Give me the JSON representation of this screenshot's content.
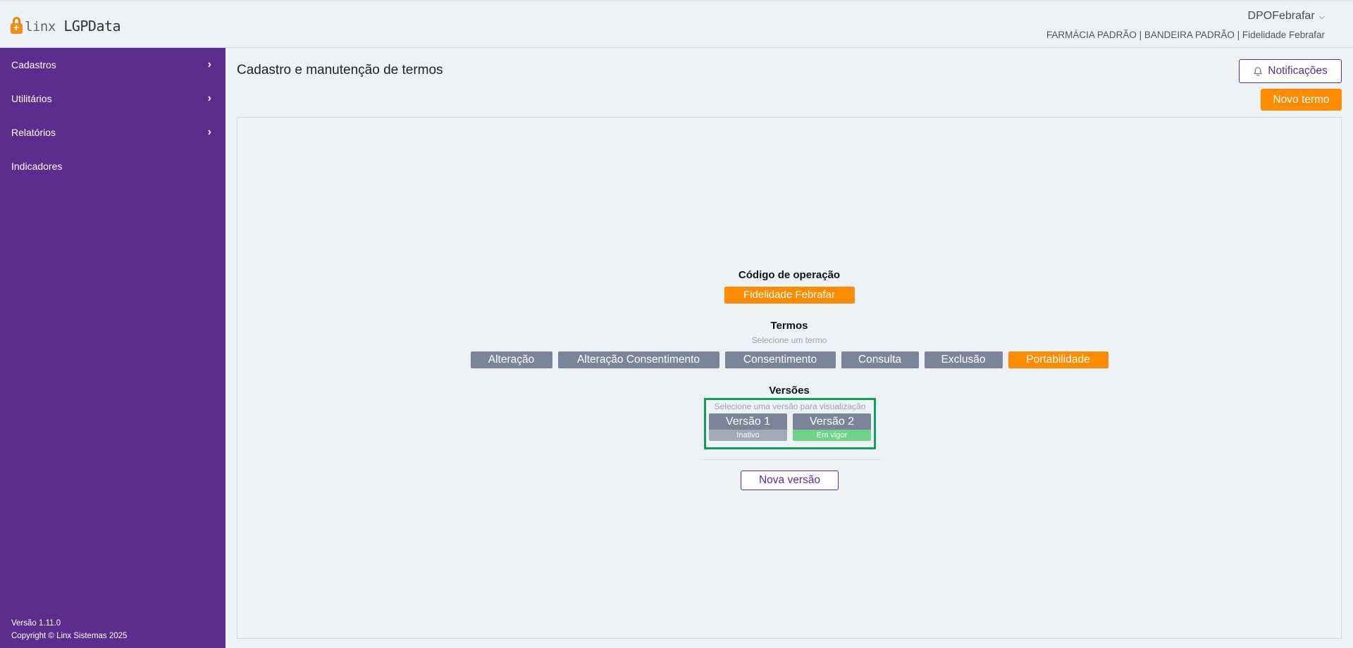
{
  "header": {
    "logo_prefix": "linx",
    "logo_name": "LGPData",
    "user_name": "DPOFebrafar",
    "context": "FARMÁCIA PADRÃO | BANDEIRA PADRÃO | Fidelidade Febrafar"
  },
  "sidebar": {
    "items": [
      {
        "label": "Cadastros",
        "has_submenu": true
      },
      {
        "label": "Utilitários",
        "has_submenu": true
      },
      {
        "label": "Relatórios",
        "has_submenu": true
      },
      {
        "label": "Indicadores",
        "has_submenu": false
      }
    ],
    "version": "Versão 1.11.0",
    "copyright": "Copyright © Linx Sistemas 2025"
  },
  "main": {
    "title": "Cadastro e manutenção de termos",
    "notifications_label": "Notificações",
    "new_term_label": "Novo termo",
    "operation": {
      "title": "Código de operação",
      "value": "Fidelidade Febrafar"
    },
    "terms": {
      "title": "Termos",
      "hint": "Selecione um termo",
      "items": [
        {
          "label": "Alteração",
          "selected": false
        },
        {
          "label": "Alteração Consentimento",
          "selected": false
        },
        {
          "label": "Consentimento",
          "selected": false
        },
        {
          "label": "Consulta",
          "selected": false
        },
        {
          "label": "Exclusão",
          "selected": false
        },
        {
          "label": "Portabilidade",
          "selected": true
        }
      ]
    },
    "versions": {
      "title": "Versões",
      "hint": "Selecione uma versão para visualização",
      "items": [
        {
          "label": "Versão 1",
          "status": "Inativo",
          "active": false
        },
        {
          "label": "Versão 2",
          "status": "Em vigor",
          "active": true
        }
      ],
      "new_version_label": "Nova versão"
    }
  },
  "colors": {
    "sidebar": "#5b2d8e",
    "accent": "#ff8c00",
    "term_default": "#7a8599",
    "status_active": "#6ed48a",
    "status_inactive": "#a1aab8",
    "highlight_border": "#119e5a"
  }
}
